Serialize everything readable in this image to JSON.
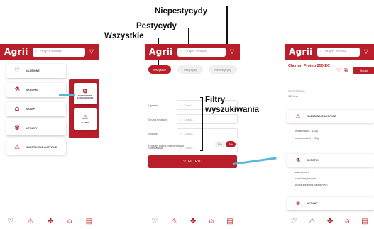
{
  "app": {
    "logo": "Agrii",
    "search_placeholder": "Znajdź środek..."
  },
  "annotations": {
    "niepestycydy": "Niepestycydy",
    "pestycydy": "Pestycydy",
    "wszystkie": "Wszystkie",
    "filtry_line1": "Filtry",
    "filtry_line2": "wyszukiwania"
  },
  "screen1": {
    "menu": [
      {
        "label": "ULUBIONE",
        "icon": "heart-icon"
      },
      {
        "label": "SKROPKI",
        "icon": "sprayer-icon"
      },
      {
        "label": "SKLEP",
        "icon": "store-icon"
      },
      {
        "label": "UPRAWY",
        "icon": "plant-icon"
      },
      {
        "label": "SUBSTANCJE AKTYWNE",
        "icon": "flask-icon"
      }
    ],
    "popup": [
      {
        "label": "WYSZUKIWANIE ZAAWANSOWANE",
        "icon": "filter-icon"
      },
      {
        "label": "ALERTY",
        "icon": "alert-icon"
      }
    ]
  },
  "screen2": {
    "tabs": [
      "Wszystkie",
      "Pestycydy",
      "Niepestycydy"
    ],
    "fields": [
      {
        "label": "Uprawa",
        "placeholder": "Znajdź..."
      },
      {
        "label": "Grupa środków",
        "placeholder": "Znajdź..."
      },
      {
        "label": "Środek",
        "placeholder": "Znajdź..."
      },
      {
        "label": "Substancja",
        "placeholder": "Znajdź..."
      }
    ],
    "toggle_label": "Produkty tylko z rotatną własną",
    "toggle_off": "Nie",
    "toggle_on": "Tak",
    "filter_button": "FILTRUJ"
  },
  "screen3": {
    "product_title": "Clayton Proteb 250 EC",
    "add_button": "Dodaj",
    "registration_label": "REJESTRACJA",
    "registration_value": "125 l/ha",
    "section1": {
      "title": "SUBSTANCJE AKTYWNE",
      "items": [
        "tebukonazol - 125g",
        "protiokonazol - 125g"
      ]
    },
    "section2": {
      "title": "SKROPKI",
      "items": [
        "szara pleśń",
        "czerń krzyżowych",
        "sucha zgnilizna kapustnych"
      ]
    },
    "section3": {
      "title": "UPRAWY"
    }
  },
  "nav": {
    "icons": [
      "heart-icon",
      "alert-icon",
      "molecule-icon",
      "bell-icon",
      "document-icon"
    ],
    "glyphs": [
      "♡",
      "⚠",
      "✤",
      "⍝",
      "▤"
    ]
  },
  "colors": {
    "brand": "#b81f2b",
    "link": "#5bb7d6"
  }
}
